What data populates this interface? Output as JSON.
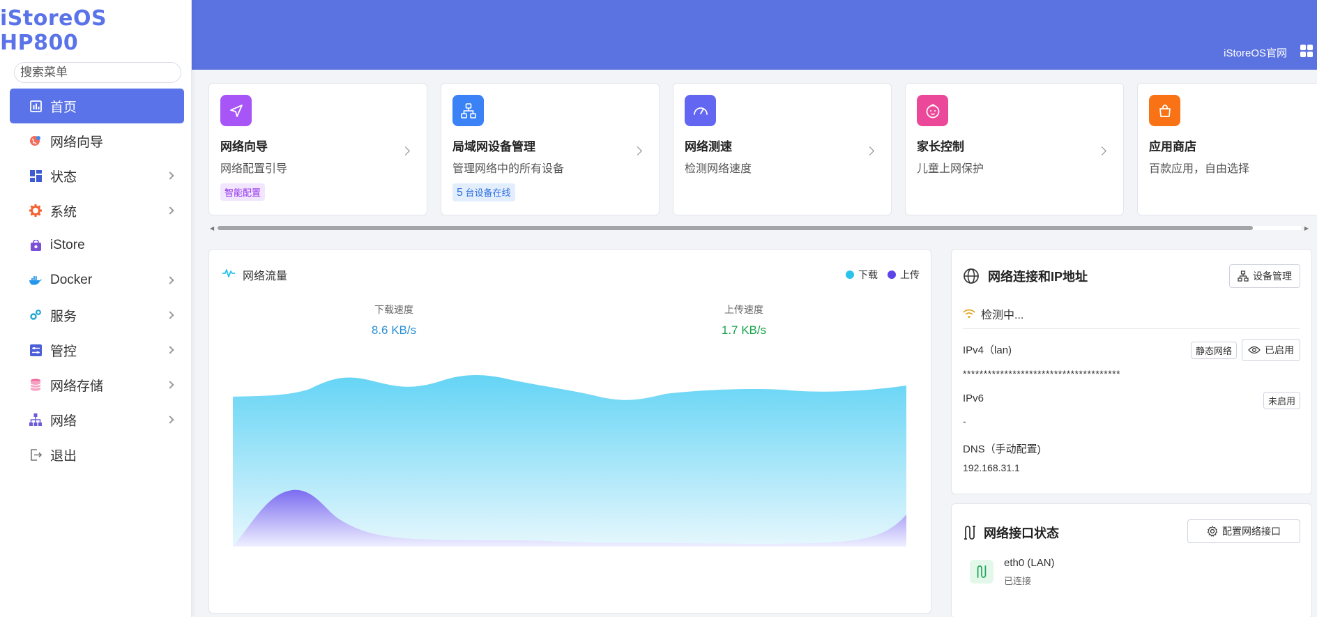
{
  "sidebar": {
    "brand": "iStoreOS HP800",
    "search_placeholder": "搜索菜单",
    "items": [
      {
        "label": "首页"
      },
      {
        "label": "网络向导"
      },
      {
        "label": "状态"
      },
      {
        "label": "系统"
      },
      {
        "label": "iStore"
      },
      {
        "label": "Docker"
      },
      {
        "label": "服务"
      },
      {
        "label": "管控"
      },
      {
        "label": "网络存储"
      },
      {
        "label": "网络"
      },
      {
        "label": "退出"
      }
    ]
  },
  "header": {
    "official_link": "iStoreOS官网"
  },
  "cards": [
    {
      "title": "网络向导",
      "desc": "网络配置引导",
      "tag": "智能配置",
      "color": "#a855f7"
    },
    {
      "title": "局域网设备管理",
      "desc": "管理网络中的所有设备",
      "tag_count": "5",
      "tag_text": "台设备在线",
      "color": "#3b82f6"
    },
    {
      "title": "网络测速",
      "desc": "检测网络速度",
      "color": "#6366f1"
    },
    {
      "title": "家长控制",
      "desc": "儿童上网保护",
      "color": "#ec4899"
    },
    {
      "title": "应用商店",
      "desc": "百款应用，自由选择",
      "color": "#f97316"
    }
  ],
  "traffic": {
    "title": "网络流量",
    "legend_download": "下载",
    "legend_upload": "上传",
    "download_label": "下载速度",
    "download_value": "8.6 KB/s",
    "upload_label": "上传速度",
    "upload_value": "1.7 KB/s",
    "download_color": "#29c3ec",
    "upload_color": "#5b45e8"
  },
  "netinfo": {
    "title": "网络连接和IP地址",
    "device_btn": "设备管理",
    "detecting": "检测中...",
    "ipv4_label": "IPv4（lan)",
    "ipv4_mode": "静态网络",
    "ipv4_status": "已启用",
    "ipv4_value": "**************************************",
    "ipv6_label": "IPv6",
    "ipv6_status": "未启用",
    "ipv6_value": "-",
    "dns_label": "DNS（手动配置)",
    "dns_value": "192.168.31.1"
  },
  "ifaces": {
    "title": "网络接口状态",
    "config_btn": "配置网络接口",
    "items": [
      {
        "name": "eth0 (LAN)",
        "status": "已连接"
      }
    ]
  }
}
